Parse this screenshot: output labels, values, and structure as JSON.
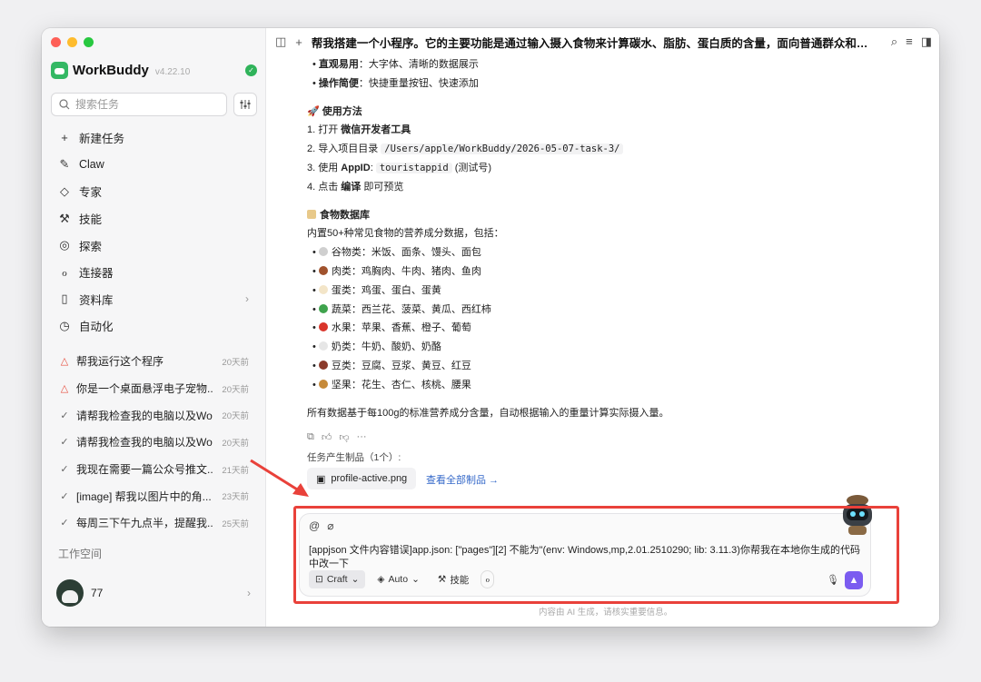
{
  "sidebar": {
    "brand_name": "WorkBuddy",
    "brand_version": "v4.22.10",
    "search_placeholder": "搜索任务",
    "nav": [
      {
        "label": "新建任务",
        "icon": "plus-icon"
      },
      {
        "label": "Claw",
        "icon": "claw-icon"
      },
      {
        "label": "专家",
        "icon": "expert-icon"
      },
      {
        "label": "技能",
        "icon": "skill-icon"
      },
      {
        "label": "探索",
        "icon": "compass-icon"
      },
      {
        "label": "连接器",
        "icon": "connector-icon"
      },
      {
        "label": "资料库",
        "icon": "book-icon"
      },
      {
        "label": "自动化",
        "icon": "clock-icon"
      }
    ],
    "history": [
      {
        "title": "帮我运行这个程序",
        "time": "20天前",
        "status": "warning"
      },
      {
        "title": "你是一个桌面悬浮电子宠物...",
        "time": "20天前",
        "status": "warning"
      },
      {
        "title": "请帮我检查我的电脑以及Wo...",
        "time": "20天前",
        "status": "done"
      },
      {
        "title": "请帮我检查我的电脑以及Wo...",
        "time": "20天前",
        "status": "done"
      },
      {
        "title": "我现在需要一篇公众号推文...",
        "time": "21天前",
        "status": "done"
      },
      {
        "title": "[image] 帮我以图片中的角...",
        "time": "23天前",
        "status": "done"
      },
      {
        "title": "每周三下午九点半，提醒我...",
        "time": "25天前",
        "status": "done"
      }
    ],
    "workspace_label": "工作空间",
    "user_name": "77"
  },
  "topbar": {
    "title": "帮我搭建一个小程序。它的主要功能是通过输入摄入食物来计算碳水、脂肪、蛋白质的含量，面向普通群众和健身爱好..."
  },
  "content": {
    "features": [
      {
        "bold": "直观易用",
        "text": "：大字体、清晰的数据展示"
      },
      {
        "bold": "操作简便",
        "text": "：快捷重量按钮、快速添加"
      }
    ],
    "usage_title": "使用方法",
    "usage_step1_prefix": "1. 打开 ",
    "usage_step1_bold": "微信开发者工具",
    "usage_step2_prefix": "2. 导入项目目录 ",
    "usage_step2_code": "/Users/apple/WorkBuddy/2026-05-07-task-3/",
    "usage_step3_prefix": "3. 使用 ",
    "usage_step3_bold": "AppID",
    "usage_step3_colon": ": ",
    "usage_step3_code": "touristappid",
    "usage_step3_suffix": " (测试号)",
    "usage_step4_prefix": "4. 点击 ",
    "usage_step4_bold": "编译",
    "usage_step4_suffix": " 即可预览",
    "db_title": "食物数据库",
    "db_intro": "内置50+种常见食物的营养成分数据，包括：",
    "db_items": [
      {
        "text": "谷物类：米饭、面条、馒头、面包",
        "color": "#cfcfcf"
      },
      {
        "text": "肉类：鸡胸肉、牛肉、猪肉、鱼肉",
        "color": "#a0522d"
      },
      {
        "text": "蛋类：鸡蛋、蛋白、蛋黄",
        "color": "#f3e5c8"
      },
      {
        "text": "蔬菜：西兰花、菠菜、黄瓜、西红柿",
        "color": "#3fa34d"
      },
      {
        "text": "水果：苹果、香蕉、橙子、葡萄",
        "color": "#d9352b"
      },
      {
        "text": "奶类：牛奶、酸奶、奶酪",
        "color": "#e6e6e6"
      },
      {
        "text": "豆类：豆腐、豆浆、黄豆、红豆",
        "color": "#8b3a2b"
      },
      {
        "text": "坚果：花生、杏仁、核桃、腰果",
        "color": "#c68a3a"
      }
    ],
    "db_note": "所有数据基于每100g的标准营养成分含量，自动根据输入的重量计算实际摄入量。",
    "artifacts_label": "任务产生制品（1个）:",
    "artifact_file": "profile-active.png",
    "view_all": "查看全部制品 →"
  },
  "composer": {
    "text": "[appjson 文件内容错误]app.json: [\"pages\"][2] 不能为\"(env: Windows,mp,2.01.2510290; lib: 3.11.3)你帮我在本地你生成的代码中改一下",
    "mode_label": "Craft",
    "model_label": "Auto",
    "skill_label": "技能"
  },
  "disclaimer": "内容由 AI 生成，请核实重要信息。",
  "colors": {
    "accent": "#7b5cf0",
    "brand": "#34b864",
    "annotation": "#e9413a",
    "link": "#3468c9"
  }
}
